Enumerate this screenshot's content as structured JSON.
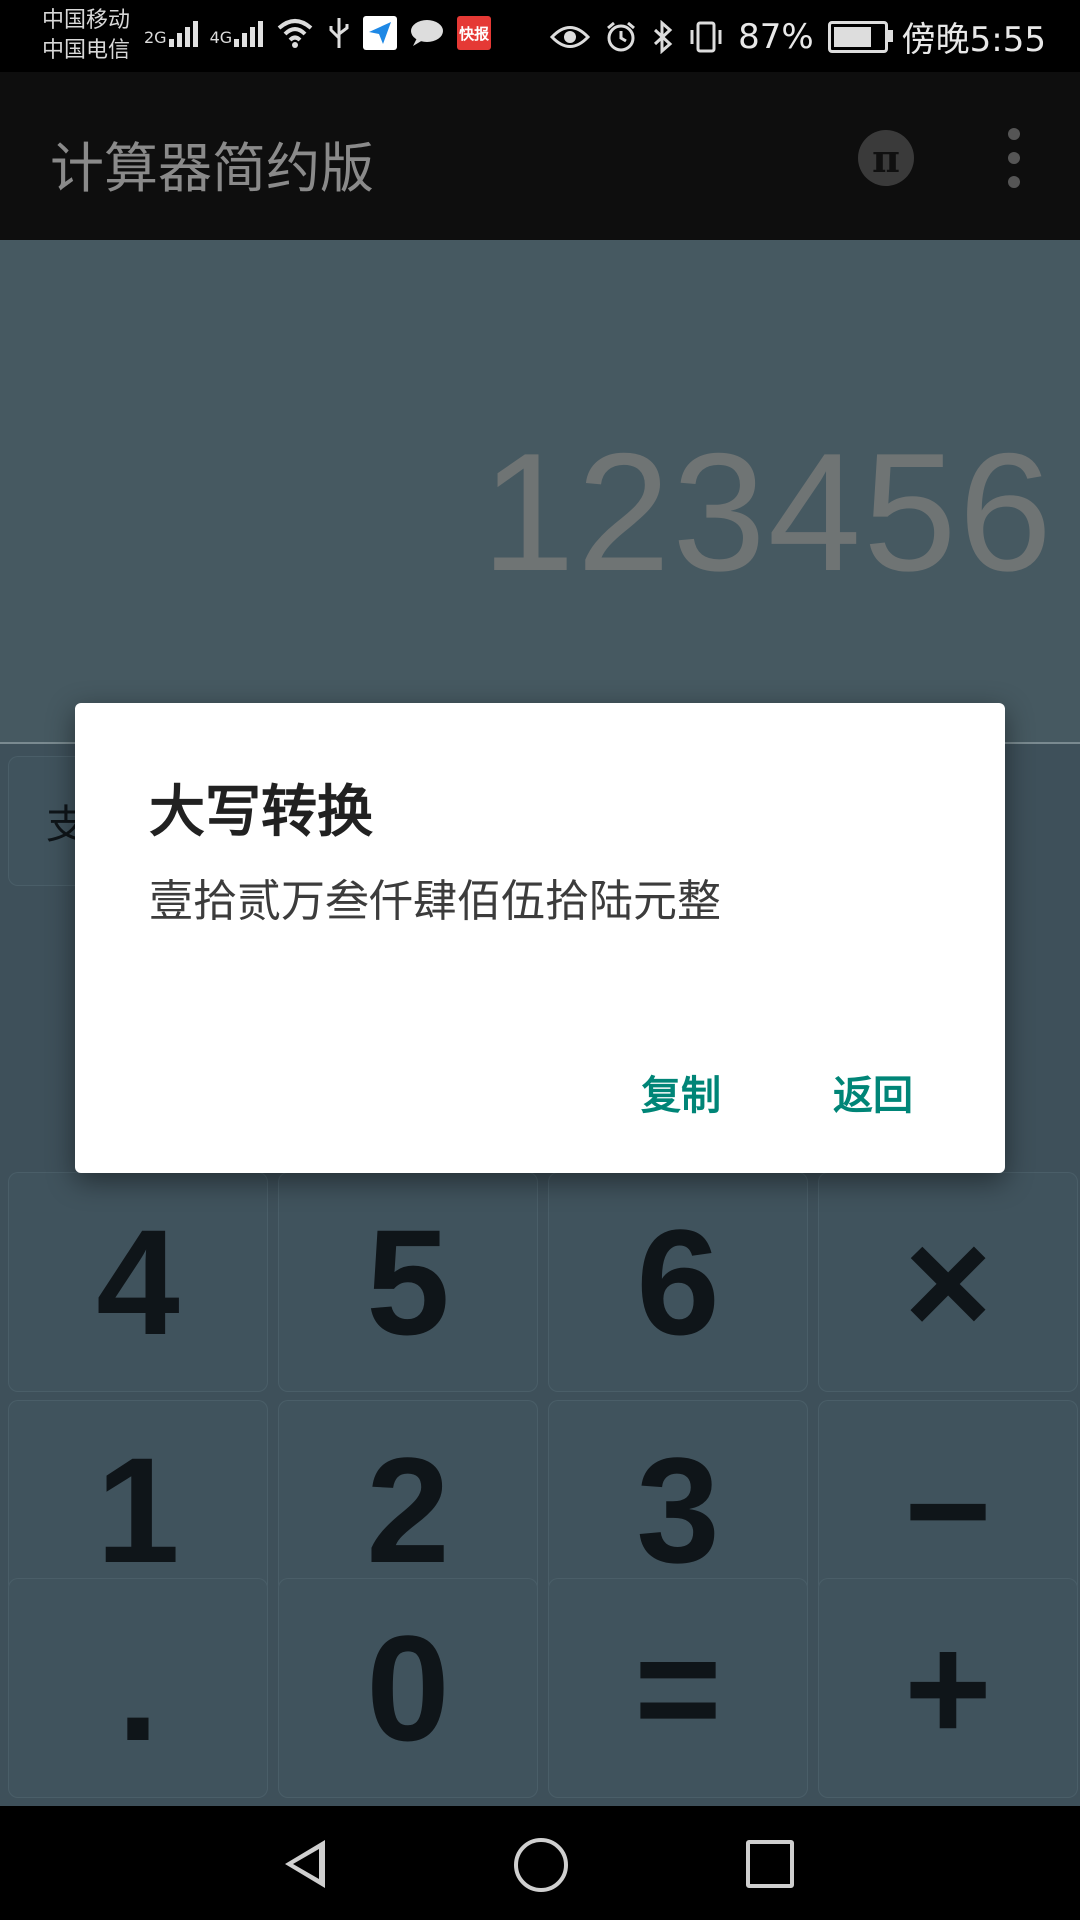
{
  "status_bar": {
    "carrier_1": "中国移动",
    "carrier_2": "中国电信",
    "net_1": "2G",
    "net_2": "4G",
    "battery_percent": "87%",
    "battery_level": 0.87,
    "time": "傍晚5:55",
    "news_icon_text": "快报",
    "icons_left": [
      "signal-icon",
      "wifi-icon",
      "usb-icon",
      "send-icon",
      "message-icon",
      "news-icon"
    ],
    "icons_right": [
      "eye-icon",
      "alarm-icon",
      "bluetooth-icon",
      "vibrate-icon",
      "battery-icon"
    ]
  },
  "app_bar": {
    "title": "计算器简约版",
    "pi_label": "π"
  },
  "display": {
    "value": "123456"
  },
  "keypad": {
    "top_left_partial": "支",
    "row4": [
      "4",
      "5",
      "6",
      "×"
    ],
    "row5": [
      "1",
      "2",
      "3",
      "−"
    ],
    "row6": [
      ".",
      "0",
      "=",
      "+"
    ]
  },
  "dialog": {
    "title": "大写转换",
    "message": "壹拾贰万叁仟肆佰伍拾陆元整",
    "copy_label": "复制",
    "back_label": "返回",
    "accent": "#008577"
  },
  "colors": {
    "display_bg": "#465961",
    "keypad_bg": "#3e505a",
    "app_bar_bg": "#0e0e0e"
  }
}
